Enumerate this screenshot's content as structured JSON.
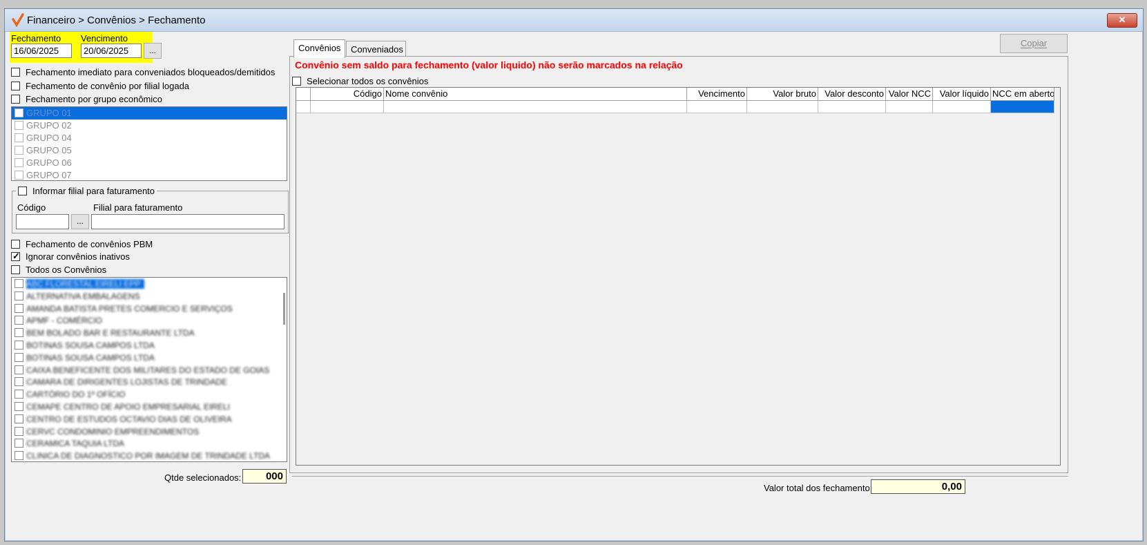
{
  "window": {
    "title": "Financeiro > Convênios > Fechamento",
    "close_label": "✕"
  },
  "dates": {
    "fechamento_label": "Fechamento",
    "fechamento_value": "16/06/2025",
    "vencimento_label": "Vencimento",
    "vencimento_value": "20/06/2025",
    "picker_label": "..."
  },
  "options": {
    "fechamento_imediato": "Fechamento imediato para conveniados bloqueados/demitidos",
    "fechamento_filial": "Fechamento de convênio por filial logada",
    "fechamento_grupo": "Fechamento por grupo econômico"
  },
  "groups": [
    {
      "label": "GRUPO 01",
      "selected": true
    },
    {
      "label": "GRUPO 02",
      "selected": false
    },
    {
      "label": "GRUPO 04",
      "selected": false
    },
    {
      "label": "GRUPO 05",
      "selected": false
    },
    {
      "label": "GRUPO 06",
      "selected": false
    },
    {
      "label": "GRUPO 07",
      "selected": false
    }
  ],
  "filial": {
    "group_label": "Informar filial para faturamento",
    "codigo_label": "Código",
    "filial_label": "Filial para faturamento",
    "codigo_value": "",
    "filial_value": "",
    "picker_label": "..."
  },
  "options2": {
    "pbm": "Fechamento de convênios PBM",
    "ignorar_inativos": "Ignorar convênios inativos",
    "todos": "Todos os Convênios"
  },
  "convenios": [
    "ABC FLORESTAL EIRELI EPP",
    "ALTERNATIVA EMBALAGENS",
    "AMANDA BATISTA PRETES COMERCIO E SERVIÇOS",
    "APMF - COMÉRCIO",
    "BEM BOLADO BAR E RESTAURANTE LTDA",
    "BOTINAS SOUSA CAMPOS LTDA",
    "BOTINAS SOUSA CAMPOS LTDA",
    "CAIXA BENEFICENTE DOS MILITARES DO ESTADO DE GOIAS",
    "CAMARA DE DIRIGENTES LOJISTAS DE TRINDADE",
    "CARTÓRIO DO 1º OFÍCIO",
    "CEMAPE CENTRO DE APOIO EMPRESARIAL EIRELI",
    "CENTRO DE ESTUDOS OCTAVIO DIAS DE OLIVEIRA",
    "CERVC CONDOMINIO EMPREENDIMENTOS",
    "CERAMICA TAQUIA LTDA",
    "CLINICA DE DIAGNOSTICO POR IMAGEM DE TRINDADE LTDA"
  ],
  "qtde": {
    "label": "Qtde selecionados:",
    "value": "000"
  },
  "tabs": {
    "convenios": "Convênios",
    "conveniados": "Conveniados"
  },
  "copiar_label": "Copiar",
  "warning": "Convênio sem saldo para fechamento (valor liquido) não serão marcados na relação",
  "select_all": "Selecionar todos os convênios",
  "table": {
    "columns": [
      "",
      "Código",
      "Nome convênio",
      "Vencimento",
      "Valor bruto",
      "Valor desconto",
      "Valor NCC",
      "Valor líquido",
      "NCC em aberto"
    ]
  },
  "total": {
    "label": "Valor total dos fechamento:",
    "value": "0,00"
  },
  "colors": {
    "highlight": "#ffff00",
    "selection": "#0a6fde",
    "warning": "#ff0000"
  }
}
